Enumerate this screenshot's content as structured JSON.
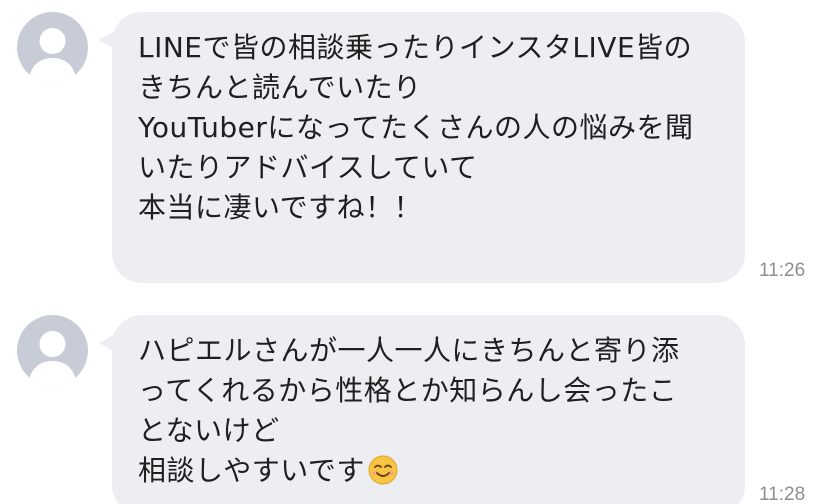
{
  "messages": [
    {
      "lines": [
        "LINEで皆の相談乗ったりインスタLIVE皆の",
        "きちんと読んでいたり",
        "YouTuberになってたくさんの人の悩みを聞",
        "いたりアドバイスしていて",
        "本当に凄いですね！！"
      ],
      "time": "11:26"
    },
    {
      "lines": [
        "ハピエルさんが一人一人にきちんと寄り添",
        "ってくれるから性格とか知らんし会ったこ",
        "とないけど",
        "相談しやすいです"
      ],
      "emoji": "smiling-face-icon",
      "time": "11:28"
    }
  ],
  "colors": {
    "bubble": "#eceef2",
    "avatar": "#c7ccd6",
    "text": "#1f1f1f",
    "time": "#8e8e93"
  }
}
